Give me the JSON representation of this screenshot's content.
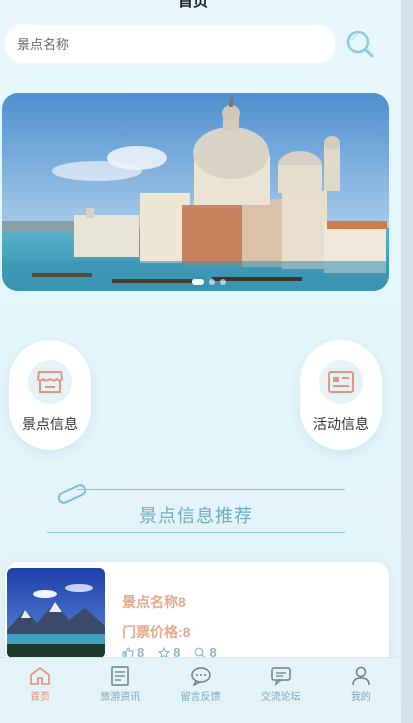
{
  "header": {
    "title": "首页"
  },
  "search": {
    "placeholder": "景点名称"
  },
  "nav_cards": [
    {
      "label": "景点信息",
      "icon": "store-icon"
    },
    {
      "label": "活动信息",
      "icon": "news-card-icon"
    }
  ],
  "section": {
    "title": "景点信息推荐"
  },
  "recommend_card": {
    "name": "景点名称8",
    "price": "门票价格:8",
    "likes": "8",
    "favorites": "8",
    "views": "8"
  },
  "tabbar": {
    "items": [
      {
        "label": "首页",
        "icon": "home-icon",
        "active": true
      },
      {
        "label": "旅游资讯",
        "icon": "news-icon",
        "active": false
      },
      {
        "label": "留言反馈",
        "icon": "message-icon",
        "active": false
      },
      {
        "label": "交流论坛",
        "icon": "forum-icon",
        "active": false
      },
      {
        "label": "我的",
        "icon": "user-icon",
        "active": false
      }
    ]
  },
  "colors": {
    "accent": "#e59172",
    "teal": "#6aaec2",
    "price": "#e7a98e",
    "inactive": "#7fa8b8"
  }
}
